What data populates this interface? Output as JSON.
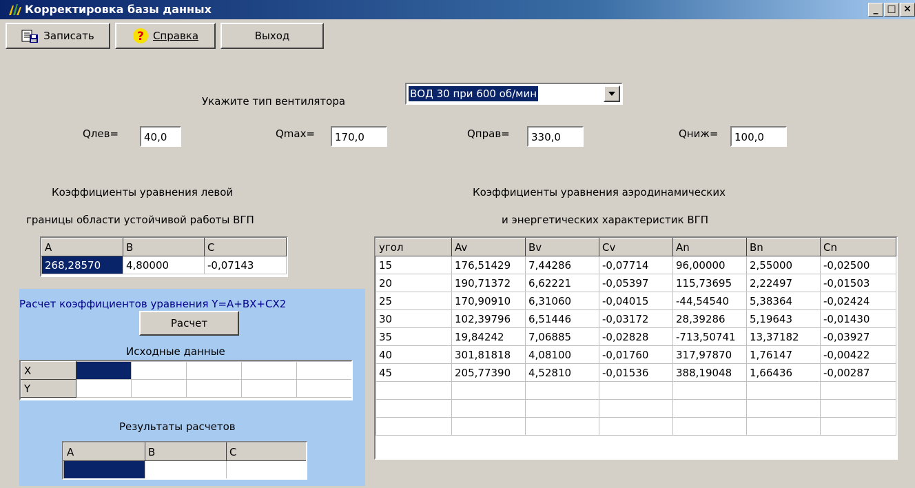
{
  "window": {
    "title": "Корректировка базы данных",
    "controls": [
      "_",
      "□",
      "×"
    ]
  },
  "toolbar": {
    "save_label": "Записать",
    "help_label": "Справка",
    "exit_label": "Выход"
  },
  "fan": {
    "prompt": "Укажите тип вентилятора",
    "selected": "ВОД 30 при 600 об/мин"
  },
  "q_fields": [
    {
      "label": "Qлев=",
      "value": "40,0"
    },
    {
      "label": "Qmax=",
      "value": "170,0"
    },
    {
      "label": "Qправ=",
      "value": "330,0"
    },
    {
      "label": "Qниж=",
      "value": "100,0"
    }
  ],
  "left_boundary": {
    "title_line1": "Коэффициенты уравнения левой",
    "title_line2": "границы области устойчивой  работы ВГП",
    "headers": [
      "A",
      "B",
      "C"
    ],
    "values": [
      "268,28570",
      "4,80000",
      "-0,07143"
    ]
  },
  "calc": {
    "title": "Расчет коэффициентов уравнения  Y=A+BX+CX2",
    "button_label": "Расчет",
    "input_title": "Исходные данные",
    "row_labels": [
      "X",
      "Y"
    ],
    "results_title": "Результаты расчетов",
    "results_headers": [
      "A",
      "B",
      "C"
    ]
  },
  "aero": {
    "title_line1": "Коэффициенты уравнения аэродинамических",
    "title_line2": "и энергетических характеристик ВГП",
    "headers": [
      "угол",
      "Av",
      "Bv",
      "Cv",
      "An",
      "Bn",
      "Cn"
    ],
    "rows": [
      [
        "15",
        "176,51429",
        "7,44286",
        "-0,07714",
        "96,00000",
        "2,55000",
        "-0,02500"
      ],
      [
        "20",
        "190,71372",
        "6,62221",
        "-0,05397",
        "115,73695",
        "2,22497",
        "-0,01503"
      ],
      [
        "25",
        "170,90910",
        "6,31060",
        "-0,04015",
        "-44,54540",
        "5,38364",
        "-0,02424"
      ],
      [
        "30",
        "102,39796",
        "6,51446",
        "-0,03172",
        "28,39286",
        "5,19643",
        "-0,01430"
      ],
      [
        "35",
        "19,84242",
        "7,06885",
        "-0,02828",
        "-713,50741",
        "13,37182",
        "-0,03927"
      ],
      [
        "40",
        "301,81818",
        "4,08100",
        "-0,01760",
        "317,97870",
        "1,76147",
        "-0,00422"
      ],
      [
        "45",
        "205,77390",
        "4,52810",
        "-0,01536",
        "388,19048",
        "1,66436",
        "-0,00287"
      ]
    ]
  }
}
